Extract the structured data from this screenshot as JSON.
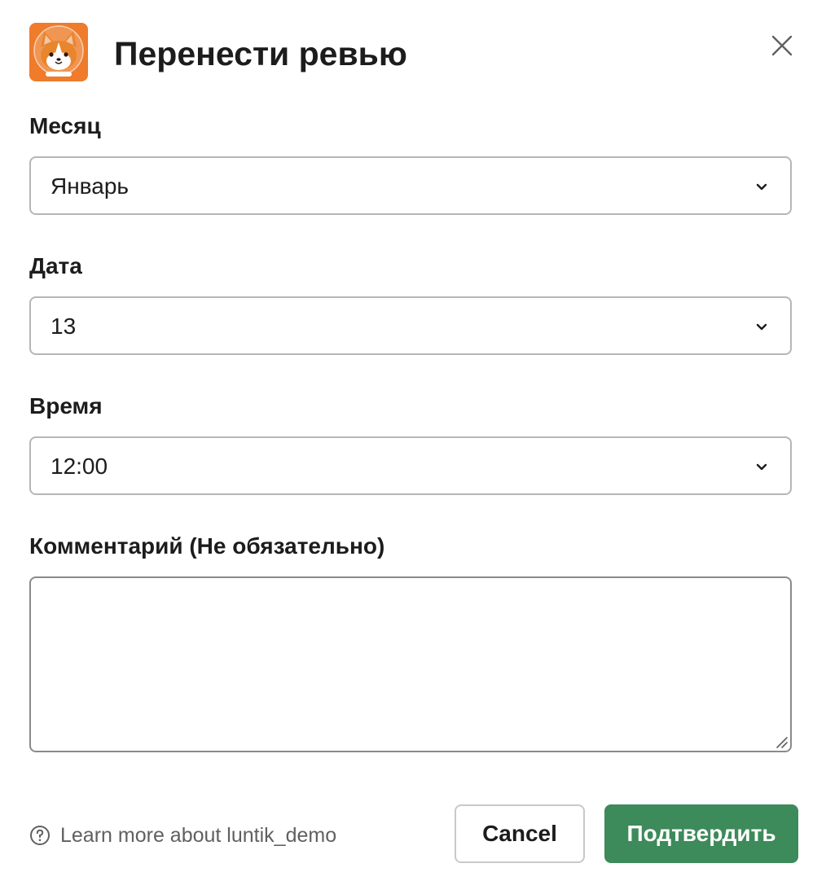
{
  "modal": {
    "title": "Перенести ревью",
    "close_icon": "close-icon",
    "app_icon": "corgi-app-icon"
  },
  "fields": {
    "month": {
      "label": "Месяц",
      "value": "Январь",
      "icon": "chevron-down-icon"
    },
    "date": {
      "label": "Дата",
      "value": "13",
      "icon": "chevron-down-icon"
    },
    "time": {
      "label": "Время",
      "value": "12:00",
      "icon": "chevron-down-icon"
    },
    "comment": {
      "label": "Комментарий (Не обязательно)",
      "value": "",
      "placeholder": ""
    }
  },
  "footer": {
    "learn_more": "Learn more about luntik_demo",
    "help_icon": "question-circle-icon",
    "cancel_label": "Cancel",
    "submit_label": "Подтвердить"
  },
  "colors": {
    "primary_button": "#3d8a5a",
    "text": "#1d1c1d",
    "muted_text": "#616061",
    "border": "#b6b6b8",
    "app_icon_bg": "#ef7b2b"
  }
}
